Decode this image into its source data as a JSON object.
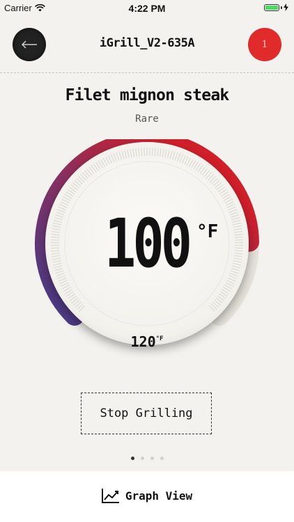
{
  "status_bar": {
    "carrier": "Carrier",
    "time": "4:22 PM"
  },
  "nav": {
    "title": "iGrill_V2-635A",
    "probe_number": "1"
  },
  "recipe": {
    "title": "Filet mignon steak",
    "doneness": "Rare"
  },
  "gauge": {
    "current_value": "100",
    "current_unit": "°F",
    "target_value": "120",
    "target_unit": "°F",
    "progress_fraction": 0.83,
    "colors": {
      "cold": "#4a3f8c",
      "hot": "#d21f26",
      "track": "#e8e5de"
    }
  },
  "actions": {
    "stop_label": "Stop Grilling",
    "graph_view_label": "Graph View"
  },
  "pager": {
    "count": 4,
    "active_index": 0
  }
}
